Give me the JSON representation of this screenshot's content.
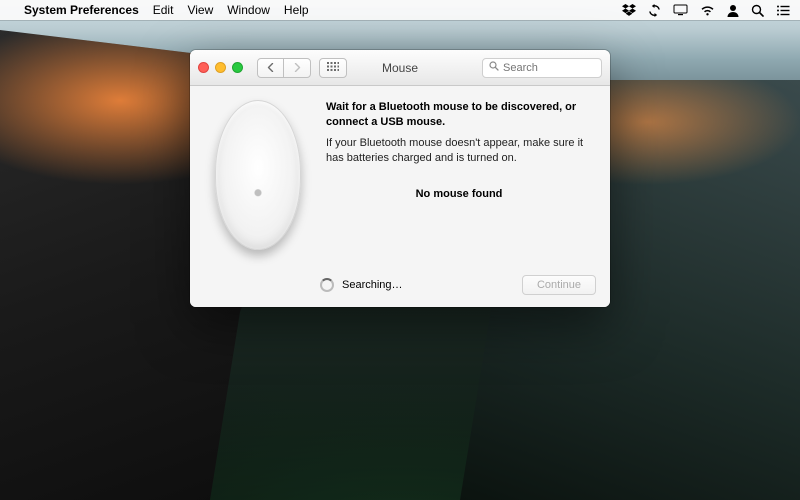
{
  "menubar": {
    "app_name": "System Preferences",
    "items": [
      "Edit",
      "View",
      "Window",
      "Help"
    ],
    "status_icons": [
      "dropbox-icon",
      "sync-icon",
      "display-icon",
      "wifi-icon",
      "user-icon",
      "spotlight-icon",
      "menu-extras-icon"
    ]
  },
  "window": {
    "title": "Mouse",
    "search_placeholder": "Search",
    "heading": "Wait for a Bluetooth mouse to be discovered, or connect a USB mouse.",
    "info": "If your Bluetooth mouse doesn't appear, make sure it has batteries charged and is turned on.",
    "status": "No mouse found",
    "searching_label": "Searching…",
    "continue_label": "Continue"
  }
}
